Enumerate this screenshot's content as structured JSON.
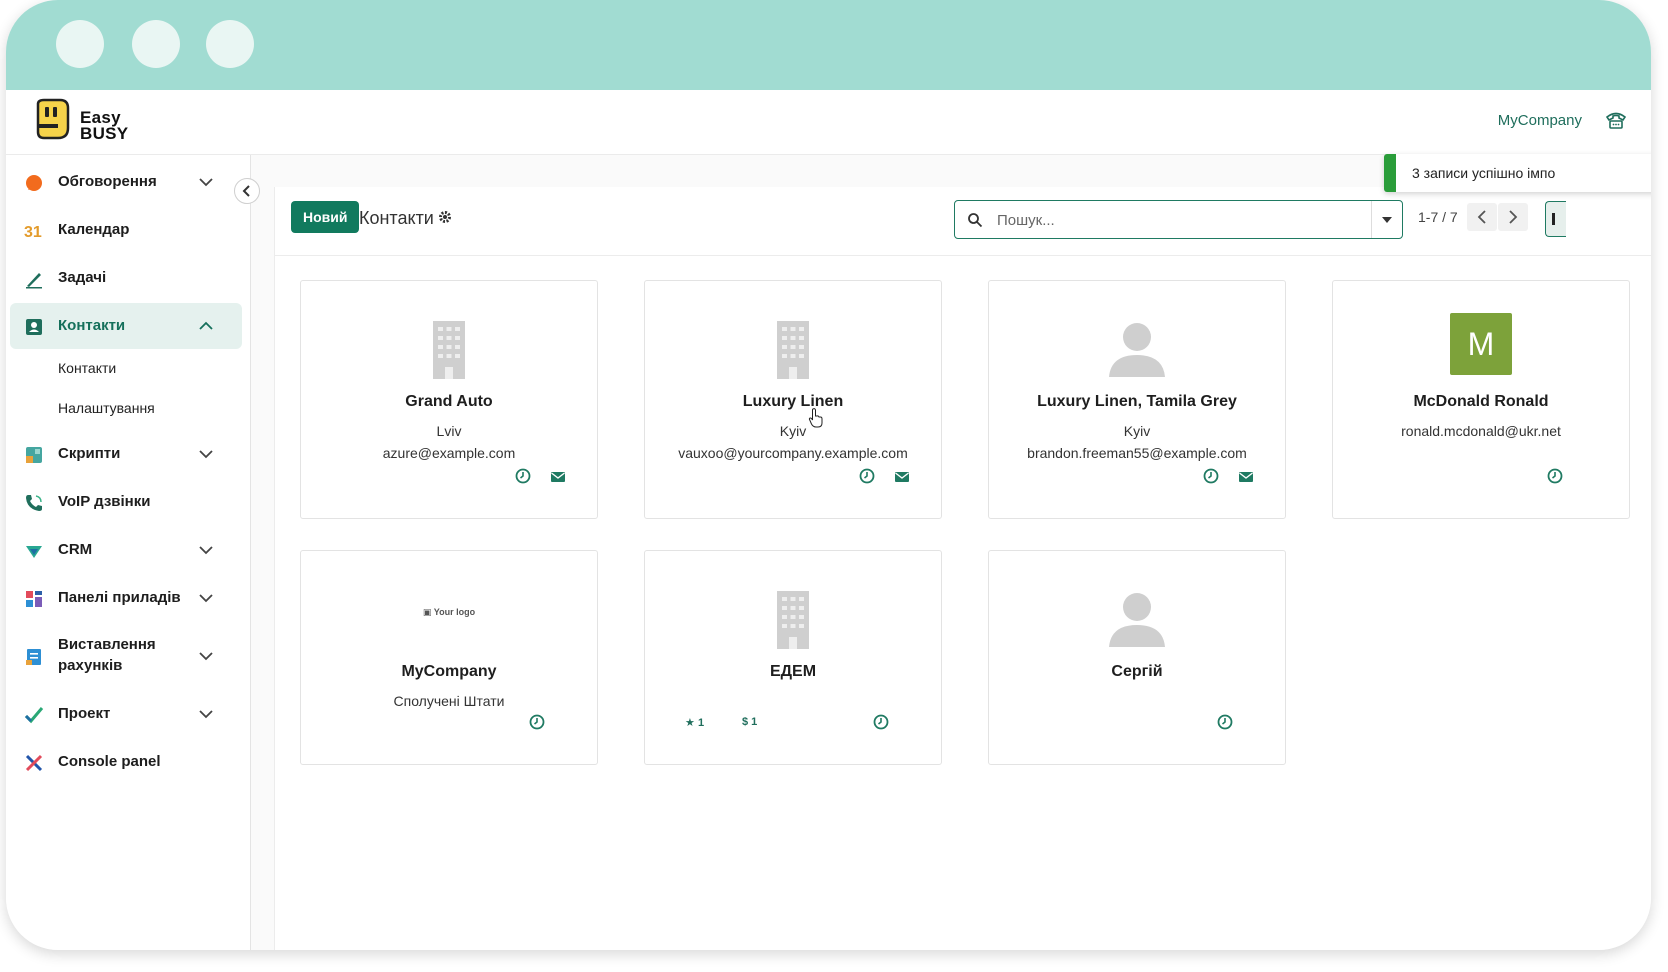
{
  "header": {
    "brand_line1": "Easy",
    "brand_line2": "BUSY",
    "company": "MyCompany"
  },
  "sidebar": {
    "items": [
      {
        "label": "Обговорення",
        "icon": "chat-bubble-icon",
        "color": "#f26b1d"
      },
      {
        "label": "Календар",
        "icon": "calendar-icon",
        "color": "#e39b2b"
      },
      {
        "label": "Задачі",
        "icon": "pencil-icon",
        "color": "#1f6e5c"
      },
      {
        "label": "Контакти",
        "icon": "contact-card-icon",
        "color": "#1f6e5c"
      },
      {
        "label": "Скрипти",
        "icon": "scripts-icon",
        "color": "#45a6a0"
      },
      {
        "label": "VoIP дзвінки",
        "icon": "phone-icon",
        "color": "#1f6e5c"
      },
      {
        "label": "CRM",
        "icon": "crm-icon",
        "color": "#28a792"
      },
      {
        "label": "Панелі приладів",
        "icon": "dashboard-icon",
        "color": "#e24b5b"
      },
      {
        "label": "Виставлення рахунків",
        "icon": "invoice-icon",
        "color": "#2d8fd4"
      },
      {
        "label": "Проект",
        "icon": "project-check-icon",
        "color": "#2aa876"
      },
      {
        "label": "Console panel",
        "icon": "tools-icon",
        "color": "#2255aa"
      }
    ],
    "subitems": [
      "Контакти",
      "Налаштування"
    ]
  },
  "control": {
    "new_label": "Новий",
    "title": "Контакти",
    "search_placeholder": "Пошук...",
    "pager": "1-7 / 7"
  },
  "toast": {
    "text": "3 записи успішно імпо"
  },
  "cards": [
    {
      "name": "Grand Auto",
      "city": "Lviv",
      "email": "azure@example.com",
      "type": "company"
    },
    {
      "name": "Luxury Linen",
      "city": "Kyiv",
      "email": "vauxoo@yourcompany.example.com",
      "type": "company"
    },
    {
      "name": "Luxury Linen, Tamila Grey",
      "city": "Kyiv",
      "email": "brandon.freeman55@example.com",
      "type": "person"
    },
    {
      "name": "McDonald Ronald",
      "city": "",
      "email": "ronald.mcdonald@ukr.net",
      "type": "initial",
      "initial": "M"
    },
    {
      "name": "MyCompany",
      "city": "Сполучені Штати",
      "email": "",
      "type": "logo",
      "logo_text": "Your logo"
    },
    {
      "name": "ЕДЕМ",
      "city": "",
      "email": "",
      "type": "company",
      "stars": "1",
      "dollars": "$ 1"
    },
    {
      "name": "Сергій",
      "city": "",
      "email": "",
      "type": "person"
    }
  ],
  "colors": {
    "accent": "#117a5e",
    "titlebar": "#a1dcd2",
    "success": "#2a9d3a",
    "avatar_m": "#7da23a"
  }
}
